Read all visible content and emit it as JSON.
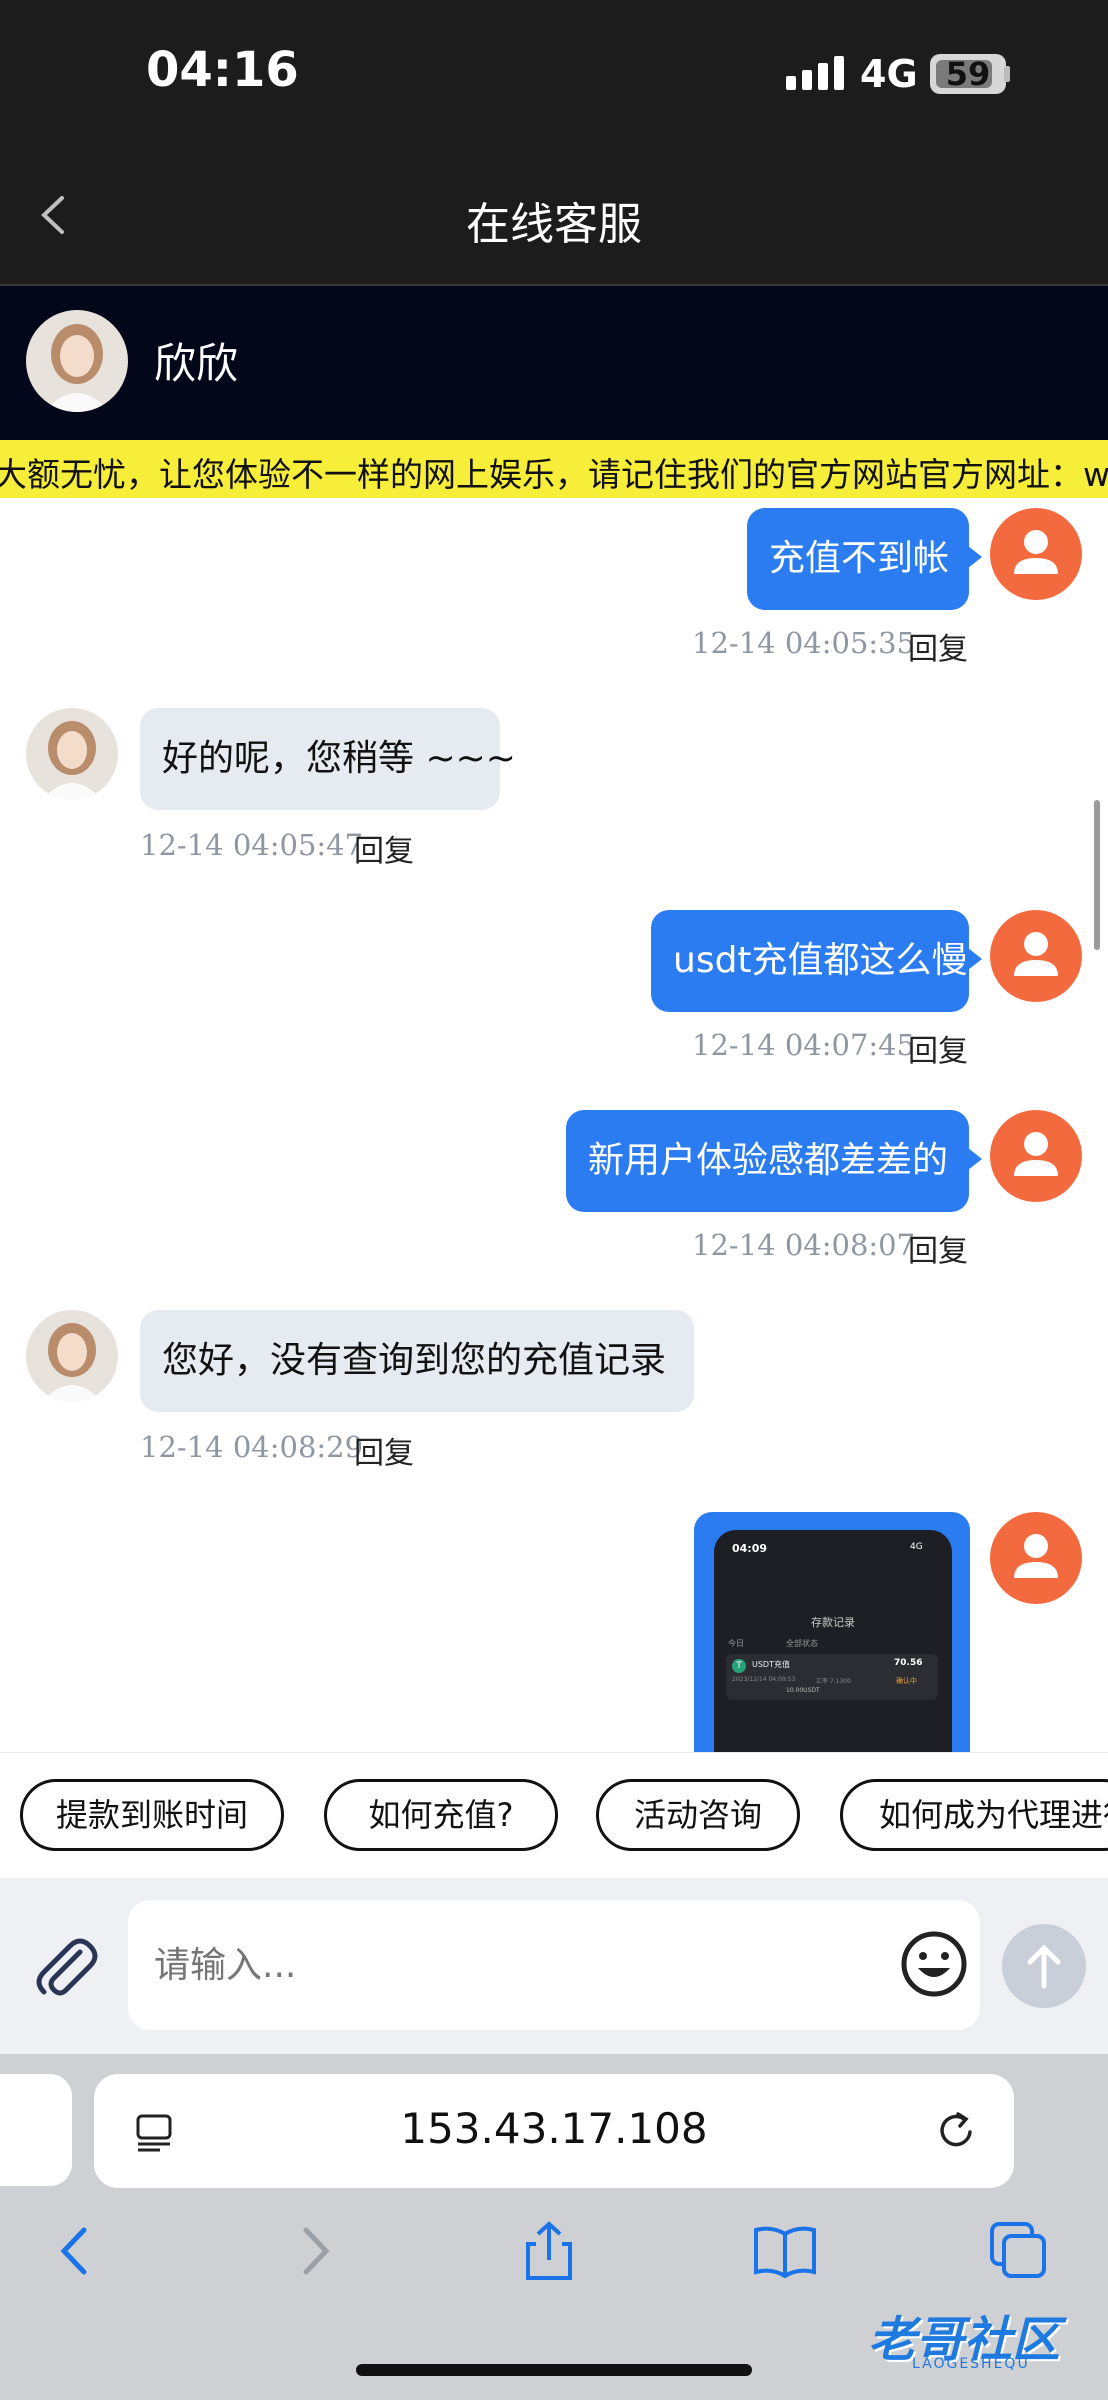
{
  "status_bar": {
    "time": "04:16",
    "network": "4G",
    "battery": "59"
  },
  "nav": {
    "title": "在线客服"
  },
  "agent": {
    "name": "欣欣"
  },
  "marquee": {
    "text": "大额无忧，让您体验不一样的网上娱乐，请记住我们的官方网站官方网址：w"
  },
  "messages": [
    {
      "sender": "user",
      "text": "充值不到帐",
      "time": "12-14 04:05:35",
      "reply": "回复"
    },
    {
      "sender": "agent",
      "text": "好的呢，您稍等 ~~~",
      "time": "12-14 04:05:47",
      "reply": "回复"
    },
    {
      "sender": "user",
      "text": "usdt充值都这么慢",
      "time": "12-14 04:07:45",
      "reply": "回复"
    },
    {
      "sender": "user",
      "text": "新用户体验感都差差的",
      "time": "12-14 04:08:07",
      "reply": "回复"
    },
    {
      "sender": "agent",
      "text": "您好，没有查询到您的充值记录",
      "time": "12-14 04:08:29",
      "reply": "回复"
    },
    {
      "sender": "user",
      "type": "image",
      "image": {
        "time": "04:09",
        "network": "4G",
        "title": "存款记录",
        "filter1": "今日",
        "filter2": "全部状态",
        "item_label": "USDT充值",
        "item_amount": "70.56",
        "item_status": "确认中",
        "item_line1": "2023/12/14 04:09:53",
        "item_line2": "汇率 7.1300",
        "item_line3": "10.00USDT"
      }
    }
  ],
  "quick_replies": [
    "提款到账时间",
    "如何充值?",
    "活动咨询",
    "如何成为代理进行"
  ],
  "input": {
    "placeholder": "请输入..."
  },
  "browser": {
    "url": "153.43.17.108"
  },
  "watermark": {
    "text": "老哥社区",
    "sub": "LAOGESHEQU"
  },
  "colors": {
    "user_bubble": "#2b7cf0",
    "agent_bubble": "#e6eaf1",
    "avatar": "#f26a3d",
    "marquee": "#f7ee3a"
  }
}
